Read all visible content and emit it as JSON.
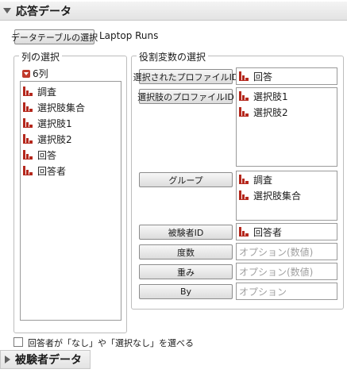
{
  "header": {
    "title": "応答データ"
  },
  "data_table": {
    "button_label": "データテーブルの選択",
    "table_name": "Laptop Runs"
  },
  "columns": {
    "group_title": "列の選択",
    "count_label": "6列",
    "items": [
      "調査",
      "選択肢集合",
      "選択肢1",
      "選択肢2",
      "回答",
      "回答者"
    ]
  },
  "roles": {
    "group_title": "役割変数の選択",
    "rows": [
      {
        "button": "選択されたプロファイルID",
        "values": [
          "回答"
        ],
        "placeholder": ""
      },
      {
        "button": "選択肢のプロファイルID",
        "values": [
          "選択肢1",
          "選択肢2"
        ],
        "placeholder": ""
      },
      {
        "button": "グループ",
        "values": [
          "調査",
          "選択肢集合"
        ],
        "placeholder": ""
      },
      {
        "button": "被験者ID",
        "values": [
          "回答者"
        ],
        "placeholder": ""
      },
      {
        "button": "度数",
        "values": [],
        "placeholder": "オプション(数値)"
      },
      {
        "button": "重み",
        "values": [],
        "placeholder": "オプション(数値)"
      },
      {
        "button": "By",
        "values": [],
        "placeholder": "オプション"
      }
    ]
  },
  "option": {
    "checkbox_label": "回答者が「なし」や「選択なし」を選べる",
    "checked": false
  },
  "footer_section": {
    "title": "被験者データ"
  },
  "icons": {
    "column_icon": "bar-chart-icon",
    "count_icon": "red-dropdown-icon"
  },
  "colors": {
    "column_icon": "#b5281d",
    "count_icon": "#c0392b"
  }
}
